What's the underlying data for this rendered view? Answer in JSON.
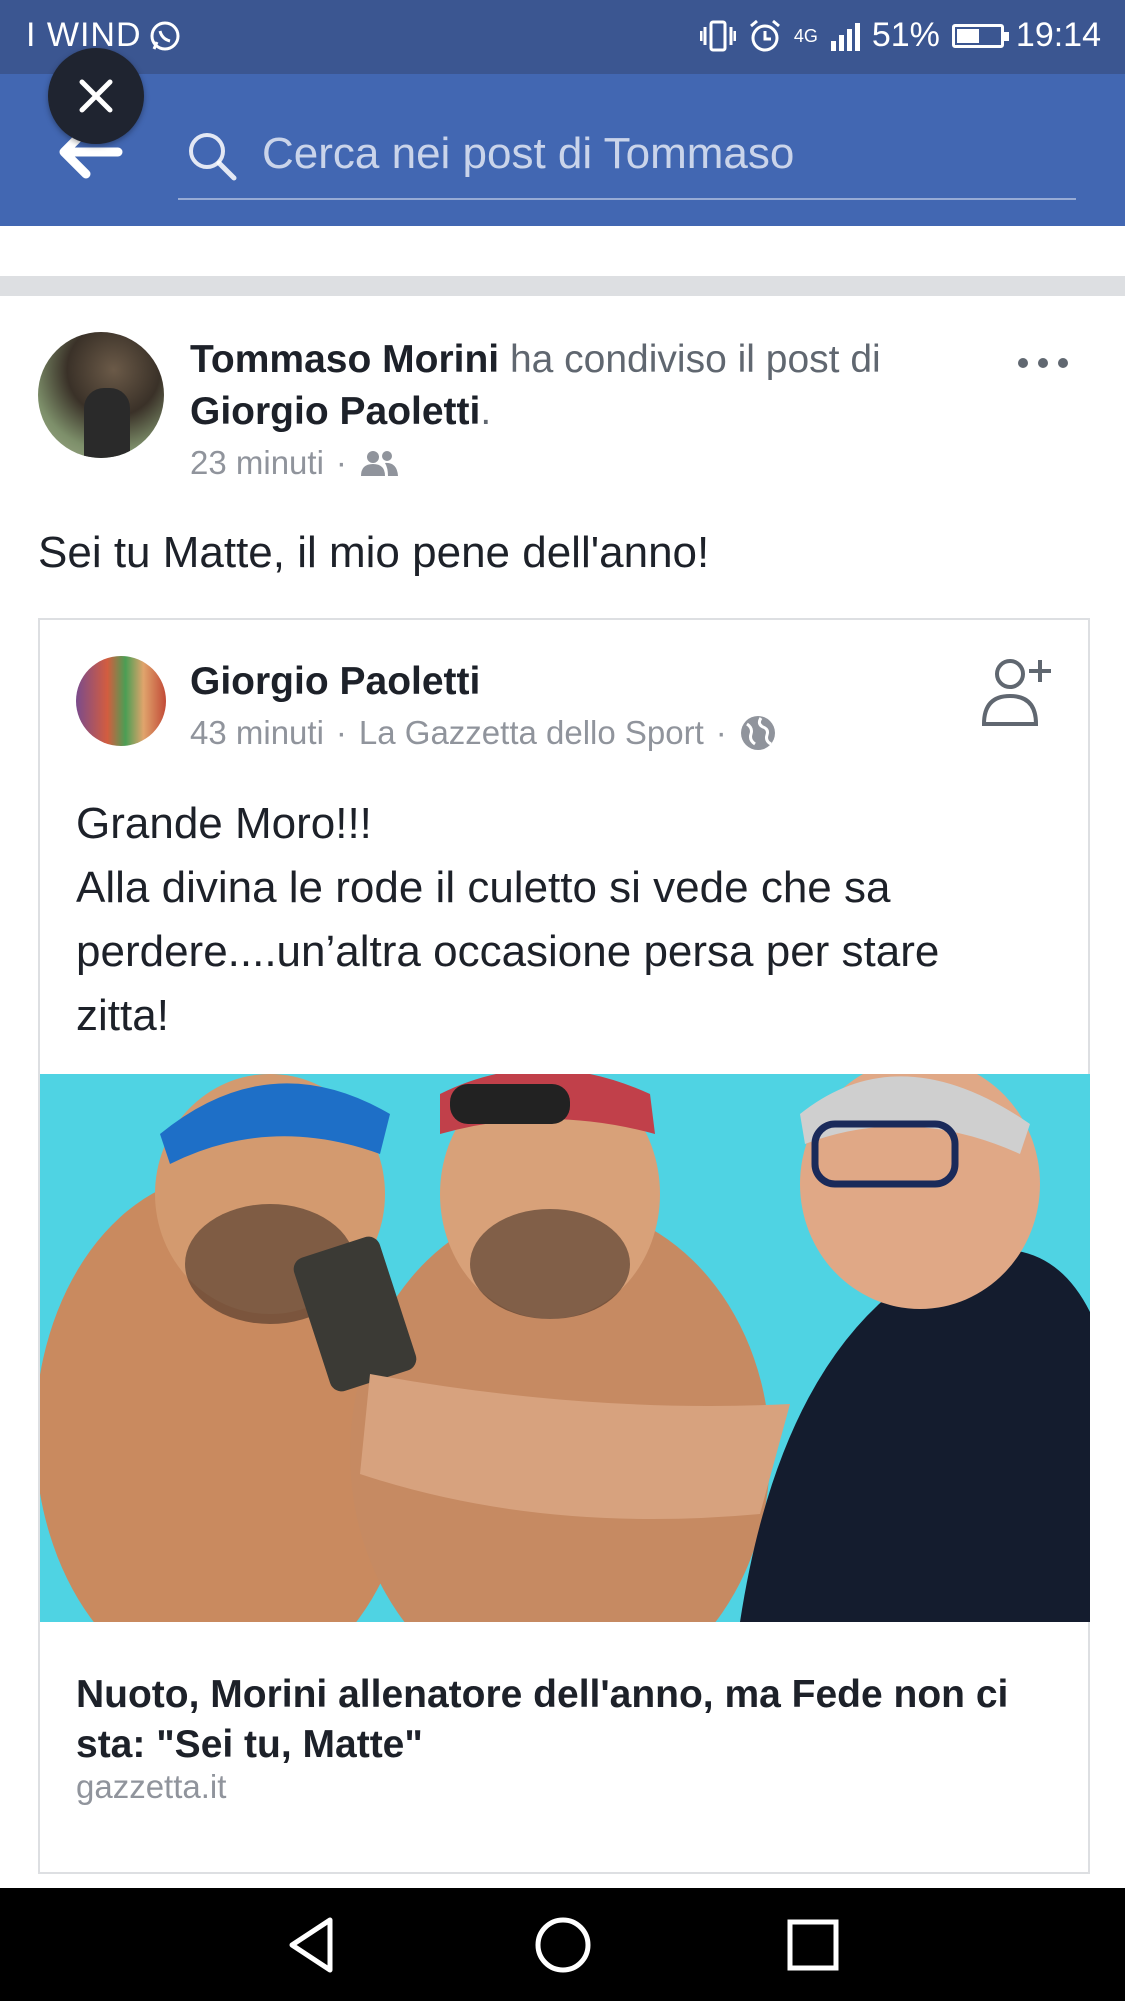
{
  "status_bar": {
    "carrier": "I WIND",
    "network": "4G",
    "battery": "51%",
    "time": "19:14",
    "battery_level": 0.51,
    "icons": [
      "whatsapp-icon",
      "vibrate-icon",
      "alarm-icon",
      "signal-icon",
      "battery-icon"
    ]
  },
  "search": {
    "placeholder": "Cerca nei post di Tommaso",
    "back_icon": "back-arrow-icon",
    "search_icon": "search-icon",
    "close_icon": "close-icon"
  },
  "post": {
    "author": "Tommaso Morini",
    "action": " ha condiviso il post di ",
    "shared_from": "Giorgio Paoletti",
    "time": "23 minuti",
    "separator": " · ",
    "audience_icon": "friends-icon",
    "text": "Sei tu Matte, il mio pene dell'anno!"
  },
  "shared": {
    "author": "Giorgio Paoletti",
    "time": "43 minuti",
    "source": "La Gazzetta dello Sport",
    "audience_icon": "globe-icon",
    "text_lines": [
      "Grande Moro!!!",
      "Alla divina le rode il culetto si vede che sa",
      "perdere....un’altra occasione persa per stare",
      "zitta!"
    ],
    "link_title": "Nuoto, Morini allenatore dell'anno, ma Fede non ci sta: \"Sei tu, Matte\"",
    "link_domain": "gazzetta.it"
  },
  "colors": {
    "header_blue": "#4267b2",
    "status_blue": "#3b5691",
    "image_background": "#4fd3e3"
  }
}
